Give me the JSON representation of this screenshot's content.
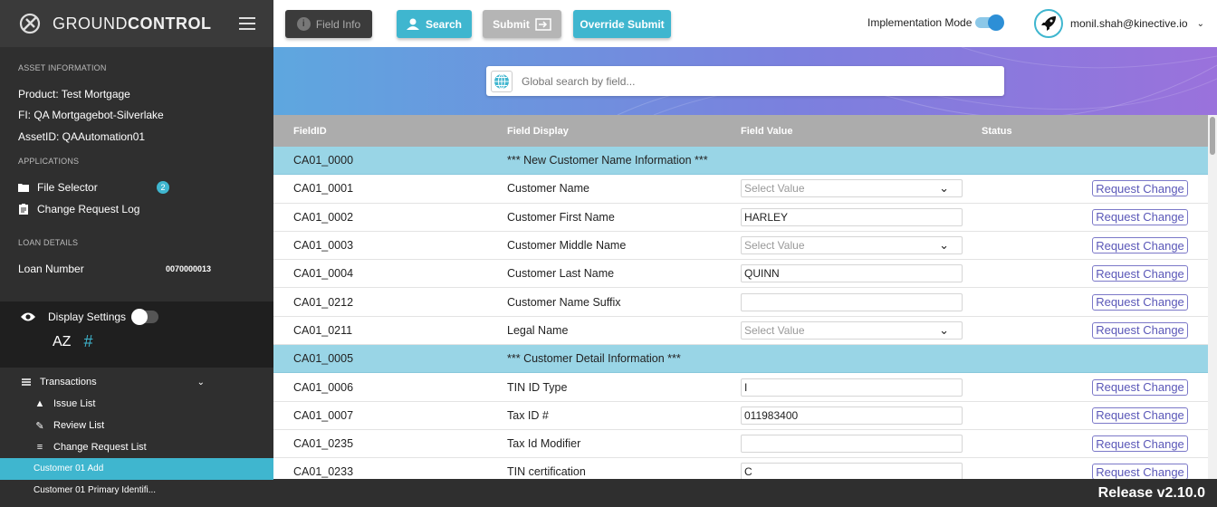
{
  "app": {
    "logo_light": "GROUND",
    "logo_bold": "CONTROL",
    "release": "Release v2.10.0"
  },
  "sidebar": {
    "asset_title": "ASSET INFORMATION",
    "product": "Product:  Test Mortgage",
    "fi": "FI:  QA Mortgagebot-Silverlake",
    "asset_id": "AssetID:  QAAutomation01",
    "applications_title": "APPLICATIONS",
    "file_selector": "File Selector",
    "file_selector_badge": "2",
    "change_request_log": "Change Request Log",
    "loan_title": "LOAN DETAILS",
    "loan_number_label": "Loan Number",
    "loan_number": "0070000013",
    "display_settings": "Display Settings",
    "sort_az": "AZ",
    "sort_hash": "#",
    "transactions": "Transactions",
    "issue_list": "Issue List",
    "review_list": "Review List",
    "change_request_list": "Change Request List",
    "customer_01_add": "Customer 01 Add",
    "customer_01_primary": "Customer 01 Primary Identifi..."
  },
  "toolbar": {
    "field_info": "Field Info",
    "search": "Search",
    "submit": "Submit",
    "override_submit": "Override Submit",
    "implementation_mode": "Implementation Mode",
    "user_email": "monil.shah@kinective.io"
  },
  "search": {
    "placeholder": "Global search by field..."
  },
  "table": {
    "headers": [
      "FieldID",
      "Field Display",
      "Field Value",
      "Status"
    ],
    "request_change_label": "Request Change",
    "select_placeholder": "Select Value",
    "rows": [
      {
        "id": "CA01_0000",
        "display": "*** New Customer Name Information ***",
        "type": "section"
      },
      {
        "id": "CA01_0001",
        "display": "Customer Name",
        "type": "select",
        "value": ""
      },
      {
        "id": "CA01_0002",
        "display": "Customer First Name",
        "type": "text",
        "value": "HARLEY"
      },
      {
        "id": "CA01_0003",
        "display": "Customer Middle Name",
        "type": "select",
        "value": ""
      },
      {
        "id": "CA01_0004",
        "display": "Customer Last Name",
        "type": "text",
        "value": "QUINN"
      },
      {
        "id": "CA01_0212",
        "display": "Customer Name Suffix",
        "type": "text",
        "value": ""
      },
      {
        "id": "CA01_0211",
        "display": "Legal Name",
        "type": "select",
        "value": ""
      },
      {
        "id": "CA01_0005",
        "display": "*** Customer Detail Information ***",
        "type": "section"
      },
      {
        "id": "CA01_0006",
        "display": "TIN ID Type",
        "type": "text",
        "value": "I"
      },
      {
        "id": "CA01_0007",
        "display": "Tax ID #",
        "type": "text",
        "value": "011983400"
      },
      {
        "id": "CA01_0235",
        "display": "Tax Id Modifier",
        "type": "text",
        "value": ""
      },
      {
        "id": "CA01_0233",
        "display": "TIN certification",
        "type": "text",
        "value": "C"
      }
    ]
  },
  "colors": {
    "accent": "#3fb6cf",
    "section_row": "#99d5e6",
    "sidebar_bg": "#2f2f2f",
    "request_change": "#5a57b8"
  }
}
